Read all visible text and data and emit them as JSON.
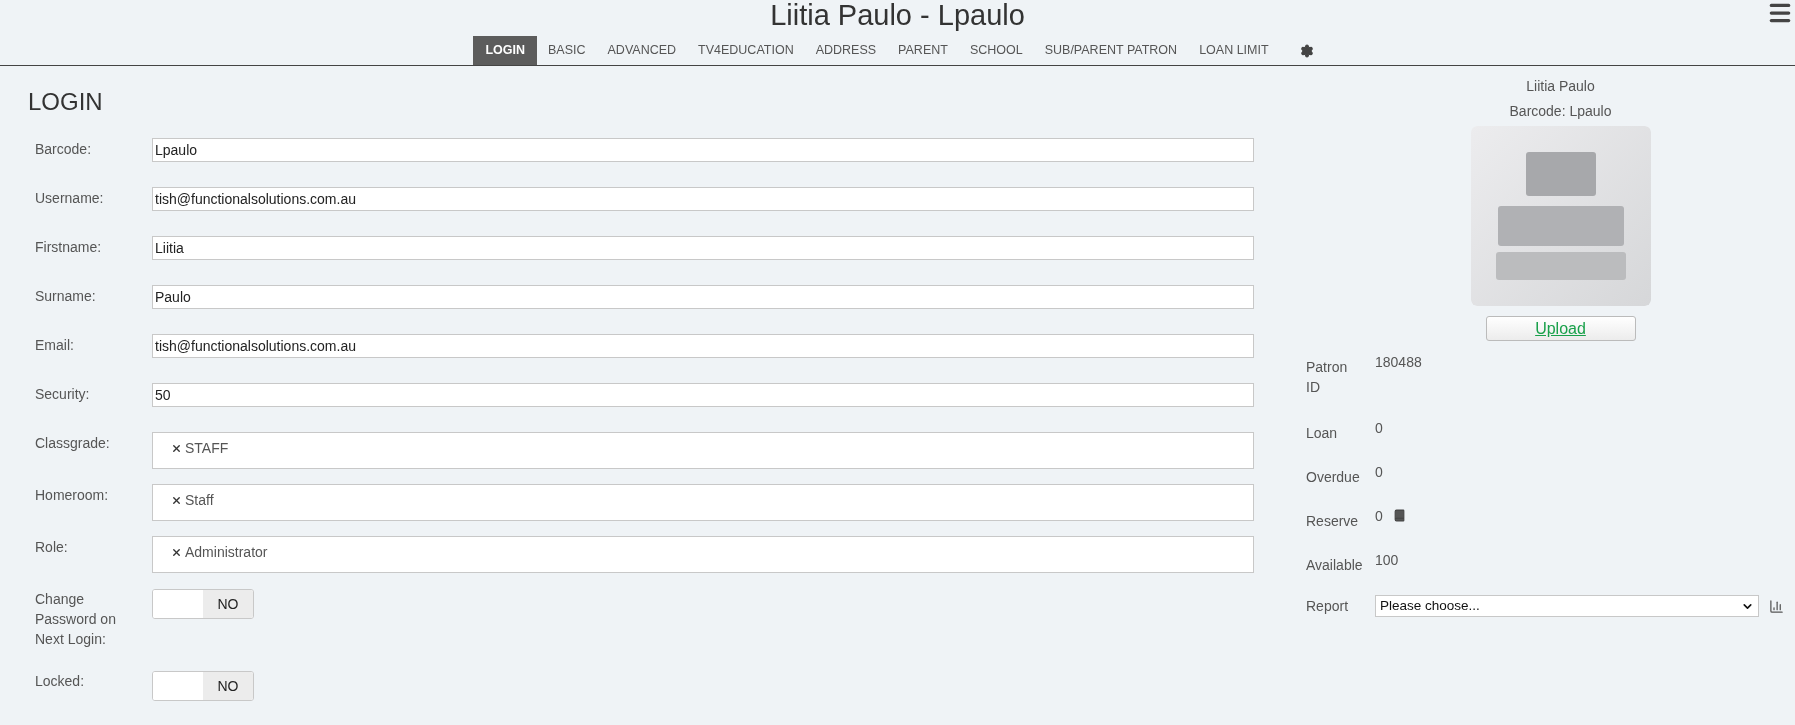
{
  "header": {
    "title": "Liitia Paulo - Lpaulo"
  },
  "tabs": [
    {
      "label": "LOGIN",
      "selected": true
    },
    {
      "label": "BASIC",
      "selected": false
    },
    {
      "label": "ADVANCED",
      "selected": false
    },
    {
      "label": "TV4EDUCATION",
      "selected": false
    },
    {
      "label": "ADDRESS",
      "selected": false
    },
    {
      "label": "PARENT",
      "selected": false
    },
    {
      "label": "SCHOOL",
      "selected": false
    },
    {
      "label": "SUB/PARENT PATRON",
      "selected": false
    },
    {
      "label": "LOAN LIMIT",
      "selected": false
    }
  ],
  "form": {
    "heading": "LOGIN",
    "fields": [
      {
        "kind": "text",
        "label": "Barcode:",
        "value": "Lpaulo"
      },
      {
        "kind": "text",
        "label": "Username:",
        "value": "tish@functionalsolutions.com.au"
      },
      {
        "kind": "text",
        "label": "Firstname:",
        "value": "Liitia"
      },
      {
        "kind": "text",
        "label": "Surname:",
        "value": "Paulo"
      },
      {
        "kind": "text",
        "label": "Email:",
        "value": "tish@functionalsolutions.com.au"
      },
      {
        "kind": "text",
        "label": "Security:",
        "value": "50"
      },
      {
        "kind": "tags",
        "label": "Classgrade:",
        "tags": [
          "STAFF"
        ]
      },
      {
        "kind": "tags",
        "label": "Homeroom:",
        "tags": [
          "Staff"
        ]
      },
      {
        "kind": "tags",
        "label": "Role:",
        "tags": [
          "Administrator"
        ]
      },
      {
        "kind": "toggle",
        "label": "Change Password on Next Login:",
        "on": false,
        "state_label": "NO"
      },
      {
        "kind": "toggle",
        "label": "Locked:",
        "on": false,
        "state_label": "NO"
      }
    ]
  },
  "profile": {
    "name": "Liitia Paulo",
    "barcode": "Barcode: Lpaulo",
    "upload_button": "Upload",
    "stats": [
      {
        "kind": "value",
        "label": "Patron ID",
        "value": "180488"
      },
      {
        "kind": "value",
        "label": "Loan",
        "value": "0"
      },
      {
        "kind": "value",
        "label": "Overdue",
        "value": "0"
      },
      {
        "kind": "book",
        "label": "Reserve",
        "value": "0"
      },
      {
        "kind": "value",
        "label": "Available",
        "value": "100"
      }
    ],
    "report": {
      "label": "Report",
      "value": "Please choose..."
    }
  }
}
